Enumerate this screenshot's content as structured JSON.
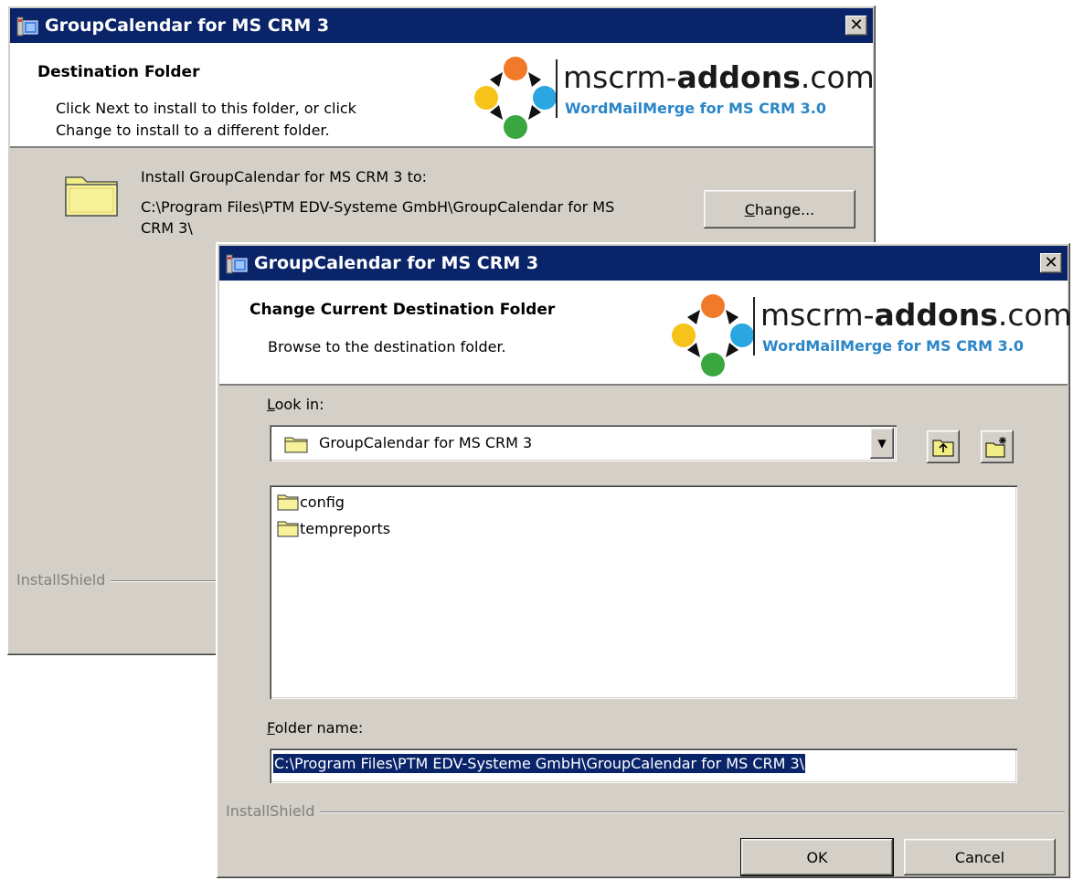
{
  "back_dialog": {
    "title": "GroupCalendar for MS CRM 3",
    "header_title": "Destination Folder",
    "header_line1": "Click Next to install to this folder, or click",
    "header_line2": "Change to install to a different folder.",
    "install_label": "Install GroupCalendar for MS CRM 3 to:",
    "path_line1": "C:\\Program Files\\PTM EDV-Systeme GmbH\\GroupCalendar for MS",
    "path_line2": "CRM 3\\",
    "change_button": {
      "accel": "C",
      "rest": "hange..."
    },
    "installshield": "InstallShield"
  },
  "logo": {
    "word_prefix": "mscrm-",
    "word_bold": "addons",
    "word_suffix": ".com",
    "tagline": "WordMailMerge for MS CRM 3.0"
  },
  "front_dialog": {
    "title": "GroupCalendar for MS CRM 3",
    "header_title": "Change Current Destination Folder",
    "header_sub": "Browse to the destination folder.",
    "look_in_label": {
      "accel": "L",
      "rest": "ook in:"
    },
    "look_in_value": "GroupCalendar for MS CRM 3",
    "folders": [
      "config",
      "tempreports"
    ],
    "folder_name_label": {
      "accel": "F",
      "rest": "older name:"
    },
    "folder_name_value": "C:\\Program Files\\PTM EDV-Systeme GmbH\\GroupCalendar for MS CRM 3\\",
    "installshield": "InstallShield",
    "ok_button": "OK",
    "cancel_button": "Cancel"
  },
  "colors": {
    "titlebar": "#0a246a",
    "face": "#d4d0c8",
    "tagline": "#2a86c9",
    "selection": "#0a246a",
    "folder": "#f2ee86"
  }
}
